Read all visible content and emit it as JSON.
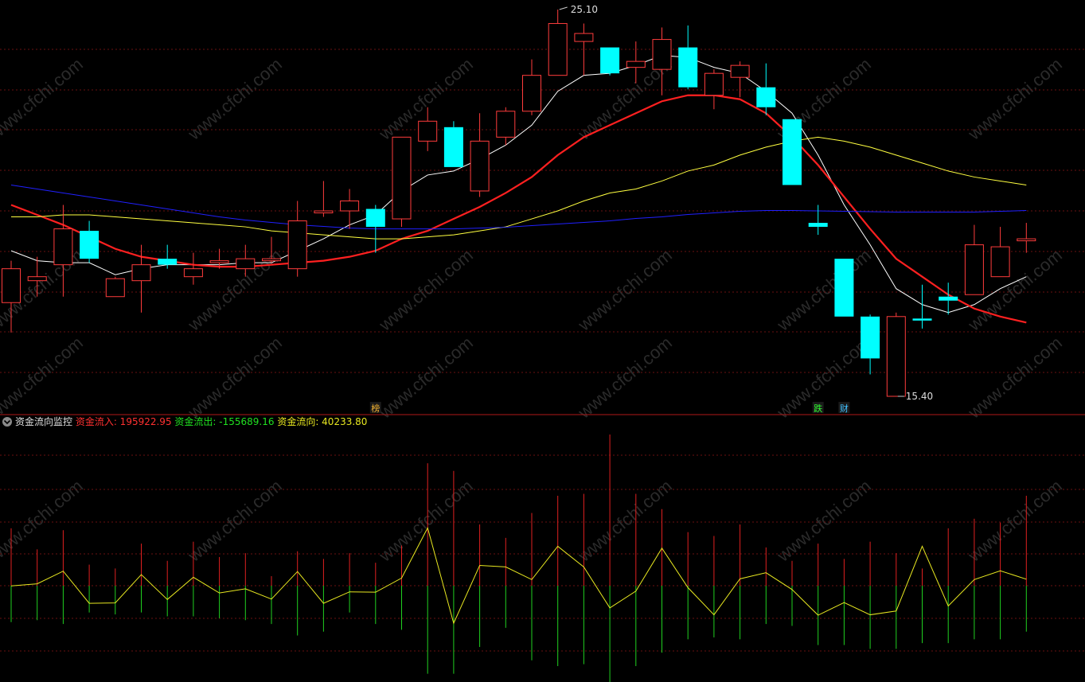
{
  "chart_data": [
    {
      "type": "candlestick",
      "title": "",
      "price_markers": {
        "high": "25.10",
        "low": "15.40"
      },
      "event_tags": [
        {
          "label": "榜",
          "bar_index": 14
        },
        {
          "label": "跌",
          "bar_index": 31
        },
        {
          "label": "财",
          "bar_index": 32
        }
      ],
      "candles": [
        {
          "o": 17.75,
          "c": 18.6,
          "h": 18.8,
          "l": 17.0
        },
        {
          "o": 18.3,
          "c": 18.4,
          "h": 18.9,
          "l": 17.9
        },
        {
          "o": 18.7,
          "c": 19.6,
          "h": 20.2,
          "l": 17.9
        },
        {
          "o": 19.55,
          "c": 18.85,
          "h": 19.8,
          "l": 18.75
        },
        {
          "o": 17.9,
          "c": 18.35,
          "h": 18.4,
          "l": 17.9
        },
        {
          "o": 18.3,
          "c": 18.7,
          "h": 19.2,
          "l": 17.5
        },
        {
          "o": 18.85,
          "c": 18.7,
          "h": 19.2,
          "l": 18.6
        },
        {
          "o": 18.4,
          "c": 18.6,
          "h": 19.0,
          "l": 18.2
        },
        {
          "o": 18.75,
          "c": 18.8,
          "h": 19.1,
          "l": 18.6
        },
        {
          "o": 18.6,
          "c": 18.85,
          "h": 19.2,
          "l": 18.4
        },
        {
          "o": 18.8,
          "c": 18.85,
          "h": 19.4,
          "l": 18.75
        },
        {
          "o": 18.6,
          "c": 19.8,
          "h": 20.3,
          "l": 18.4
        },
        {
          "o": 20.0,
          "c": 20.05,
          "h": 20.8,
          "l": 19.9
        },
        {
          "o": 20.05,
          "c": 20.3,
          "h": 20.6,
          "l": 19.6
        },
        {
          "o": 20.1,
          "c": 19.65,
          "h": 20.2,
          "l": 19.0
        },
        {
          "o": 19.85,
          "c": 21.9,
          "h": 21.9,
          "l": 19.65
        },
        {
          "o": 21.8,
          "c": 22.3,
          "h": 22.65,
          "l": 21.55
        },
        {
          "o": 22.15,
          "c": 21.15,
          "h": 22.3,
          "l": 21.15
        },
        {
          "o": 20.55,
          "c": 21.8,
          "h": 22.5,
          "l": 20.4
        },
        {
          "o": 21.9,
          "c": 22.55,
          "h": 22.65,
          "l": 21.7
        },
        {
          "o": 22.55,
          "c": 23.45,
          "h": 23.85,
          "l": 22.45
        },
        {
          "o": 23.45,
          "c": 24.75,
          "h": 25.1,
          "l": 23.45
        },
        {
          "o": 24.3,
          "c": 24.5,
          "h": 24.75,
          "l": 23.45
        },
        {
          "o": 24.15,
          "c": 23.5,
          "h": 24.15,
          "l": 23.45
        },
        {
          "o": 23.65,
          "c": 23.8,
          "h": 24.3,
          "l": 23.25
        },
        {
          "o": 23.6,
          "c": 24.35,
          "h": 24.65,
          "l": 22.95
        },
        {
          "o": 24.15,
          "c": 23.15,
          "h": 24.7,
          "l": 23.1
        },
        {
          "o": 22.95,
          "c": 23.5,
          "h": 23.6,
          "l": 22.6
        },
        {
          "o": 23.4,
          "c": 23.7,
          "h": 23.8,
          "l": 22.9
        },
        {
          "o": 23.15,
          "c": 22.65,
          "h": 23.75,
          "l": 22.45
        },
        {
          "o": 22.35,
          "c": 20.7,
          "h": 22.35,
          "l": 20.7
        },
        {
          "o": 19.75,
          "c": 19.65,
          "h": 20.2,
          "l": 19.45
        },
        {
          "o": 18.85,
          "c": 17.4,
          "h": 18.85,
          "l": 17.4
        },
        {
          "o": 17.4,
          "c": 16.35,
          "h": 17.45,
          "l": 15.95
        },
        {
          "o": 15.4,
          "c": 17.4,
          "h": 17.5,
          "l": 15.4
        },
        {
          "o": 17.35,
          "c": 17.3,
          "h": 18.2,
          "l": 17.1
        },
        {
          "o": 17.9,
          "c": 17.8,
          "h": 18.25,
          "l": 17.45
        },
        {
          "o": 17.95,
          "c": 19.2,
          "h": 19.7,
          "l": 17.95
        },
        {
          "o": 18.4,
          "c": 19.15,
          "h": 19.65,
          "l": 18.4
        },
        {
          "o": 19.3,
          "c": 19.35,
          "h": 19.75,
          "l": 19.0
        }
      ],
      "series": [
        {
          "color": "#ffffff",
          "values": [
            19.05,
            18.8,
            18.75,
            18.75,
            18.45,
            18.6,
            18.7,
            18.7,
            18.7,
            18.75,
            18.75,
            19.05,
            19.35,
            19.7,
            19.95,
            20.55,
            20.95,
            21.05,
            21.35,
            21.7,
            22.2,
            23.05,
            23.45,
            23.5,
            23.7,
            23.95,
            23.9,
            23.65,
            23.5,
            23.05,
            22.5,
            21.45,
            20.2,
            19.2,
            18.1,
            17.7,
            17.5,
            17.7,
            18.1,
            18.4
          ]
        },
        {
          "color": "#ff2020",
          "values": [
            20.2,
            19.95,
            19.7,
            19.4,
            19.1,
            18.9,
            18.8,
            18.7,
            18.65,
            18.65,
            18.7,
            18.75,
            18.8,
            18.9,
            19.05,
            19.35,
            19.55,
            19.85,
            20.15,
            20.5,
            20.9,
            21.45,
            21.9,
            22.2,
            22.5,
            22.8,
            22.95,
            22.95,
            22.85,
            22.5,
            21.9,
            21.2,
            20.4,
            19.6,
            18.85,
            18.4,
            17.95,
            17.6,
            17.4,
            17.25
          ]
        },
        {
          "color": "#ffff40",
          "values": [
            19.9,
            19.9,
            19.95,
            19.95,
            19.9,
            19.85,
            19.8,
            19.75,
            19.7,
            19.65,
            19.55,
            19.5,
            19.45,
            19.4,
            19.35,
            19.35,
            19.4,
            19.45,
            19.55,
            19.65,
            19.85,
            20.05,
            20.3,
            20.5,
            20.6,
            20.8,
            21.05,
            21.2,
            21.45,
            21.65,
            21.8,
            21.9,
            21.8,
            21.65,
            21.45,
            21.25,
            21.05,
            20.9,
            20.8,
            20.7
          ]
        },
        {
          "color": "#2020ff",
          "values": [
            20.7,
            20.6,
            20.5,
            20.4,
            20.3,
            20.2,
            20.1,
            20.0,
            19.9,
            19.82,
            19.76,
            19.7,
            19.66,
            19.62,
            19.6,
            19.6,
            19.6,
            19.6,
            19.62,
            19.64,
            19.68,
            19.72,
            19.76,
            19.8,
            19.86,
            19.9,
            19.96,
            20.0,
            20.04,
            20.06,
            20.06,
            20.05,
            20.04,
            20.03,
            20.02,
            20.02,
            20.02,
            20.02,
            20.04,
            20.06
          ]
        }
      ]
    },
    {
      "type": "bar",
      "title": "资金流向监控",
      "legend": [
        {
          "name": "资金流入",
          "value": "195922.95",
          "color": "#ff3030"
        },
        {
          "name": "资金流出",
          "value": "-155689.16",
          "color": "#20e020"
        },
        {
          "name": "资金流向",
          "value": "40233.80",
          "color": "#e8e820"
        }
      ],
      "inflow": [
        150000,
        95000,
        145000,
        55000,
        45000,
        110000,
        65000,
        115000,
        75000,
        85000,
        25000,
        90000,
        70000,
        85000,
        60000,
        105000,
        320000,
        300000,
        160000,
        125000,
        190000,
        235000,
        240000,
        395000,
        240000,
        200000,
        140000,
        130000,
        160000,
        100000,
        65000,
        110000,
        70000,
        115000,
        85000,
        45000,
        150000,
        175000,
        165000,
        235000
      ],
      "outflow": [
        -95000,
        -90000,
        -100000,
        -70000,
        -75000,
        -70000,
        -80000,
        -80000,
        -85000,
        -90000,
        -100000,
        -130000,
        -120000,
        -70000,
        -100000,
        -115000,
        -230000,
        -230000,
        -160000,
        -110000,
        -195000,
        -210000,
        -205000,
        -260000,
        -210000,
        -175000,
        -140000,
        -135000,
        -140000,
        -100000,
        -105000,
        -155000,
        -155000,
        -165000,
        -165000,
        -150000,
        -150000,
        -140000,
        -140000,
        -120000
      ],
      "net": [
        -500,
        5000,
        38000,
        -46000,
        -45000,
        29000,
        -36000,
        22000,
        -19000,
        -8000,
        -35000,
        37000,
        -46000,
        -16000,
        -17000,
        20000,
        151000,
        -98000,
        53000,
        49000,
        16000,
        103000,
        49000,
        -58000,
        -14000,
        98000,
        -5000,
        -76000,
        18000,
        34000,
        -10000,
        -77000,
        -44000,
        -76000,
        -66000,
        103000,
        -53000,
        16000,
        39000,
        17000
      ]
    }
  ],
  "watermark": "www.cfchi.com"
}
